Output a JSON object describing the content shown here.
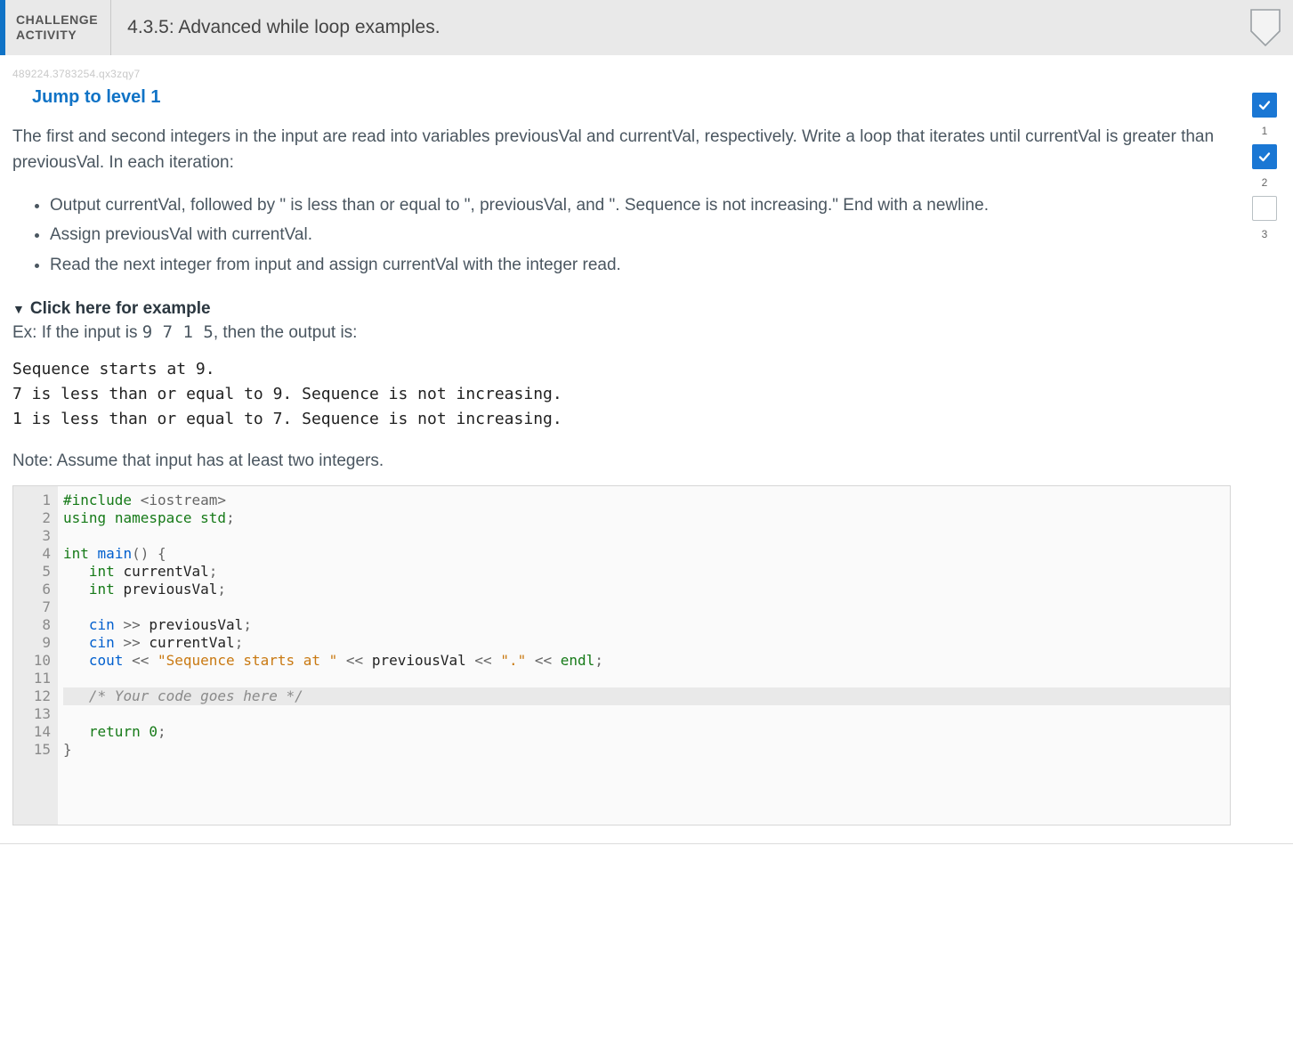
{
  "header": {
    "label_line1": "CHALLENGE",
    "label_line2": "ACTIVITY",
    "title": "4.3.5: Advanced while loop examples."
  },
  "tracking_id": "489224.3783254.qx3zqy7",
  "jump_label": "Jump to level 1",
  "prompt_lead": "The first and second integers in the input are read into variables previousVal and currentVal, respectively. Write a loop that iterates until currentVal is greater than previousVal. In each iteration:",
  "steps": [
    "Output currentVal, followed by \" is less than or equal to \", previousVal, and \". Sequence is not increasing.\" End with a newline.",
    "Assign previousVal with currentVal.",
    "Read the next integer from input and assign currentVal with the integer read."
  ],
  "example": {
    "toggle_label": "Click here for example",
    "intro_prefix": "Ex: If the input is ",
    "intro_input": "9 7 1 5",
    "intro_suffix": ", then the output is:",
    "output": "Sequence starts at 9.\n7 is less than or equal to 9. Sequence is not increasing.\n1 is less than or equal to 7. Sequence is not increasing."
  },
  "note": "Note: Assume that input has at least two integers.",
  "code": {
    "highlight_line": 12,
    "lines": [
      "#include <iostream>",
      "using namespace std;",
      "",
      "int main() {",
      "   int currentVal;",
      "   int previousVal;",
      "",
      "   cin >> previousVal;",
      "   cin >> currentVal;",
      "   cout << \"Sequence starts at \" << previousVal << \".\" << endl;",
      "",
      "   /* Your code goes here */",
      "",
      "   return 0;",
      "}"
    ]
  },
  "levels": [
    {
      "n": "1",
      "done": true
    },
    {
      "n": "2",
      "done": true
    },
    {
      "n": "3",
      "done": false
    }
  ]
}
